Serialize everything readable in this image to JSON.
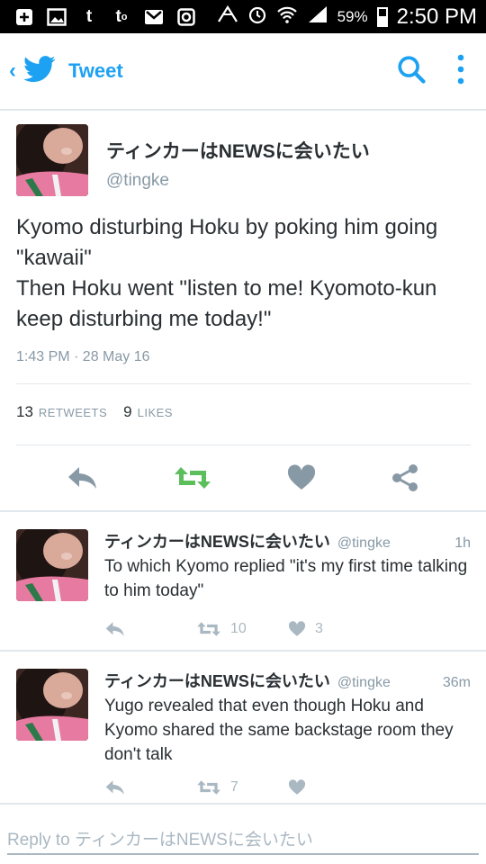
{
  "status_bar": {
    "battery": "59%",
    "time": "2:50 PM",
    "left_icons": [
      "plus-box-icon",
      "image-icon",
      "twitter-t-icon",
      "twitter-notify-icon",
      "gmail-icon",
      "instagram-icon"
    ]
  },
  "app_bar": {
    "title": "Tweet",
    "brand_color": "#1da1f2"
  },
  "main_tweet": {
    "name": "ティンカーはNEWSに会いたい",
    "handle": "@tingke",
    "text_line1": "Kyomo disturbing Hoku by poking him going \"kawaii\"",
    "text_line2": "Then Hoku went \"listen to me! Kyomoto-kun keep disturbing me today!\"",
    "timestamp": "1:43 PM · 28 May 16",
    "retweets_count": "13",
    "retweets_label": "RETWEETS",
    "likes_count": "9",
    "likes_label": "LIKES"
  },
  "replies": [
    {
      "name": "ティンカーはNEWSに会いたい",
      "handle": "@tingke",
      "time": "1h",
      "text": "To which Kyomo replied \"it's my first time talking to him today\"",
      "retweets": "10",
      "likes": "3"
    },
    {
      "name": "ティンカーはNEWSに会いたい",
      "handle": "@tingke",
      "time": "36m",
      "text": "Yugo revealed that even though Hoku and Kyomo shared the same backstage room they don't talk",
      "retweets": "7",
      "likes": ""
    }
  ],
  "reply_bar": {
    "prefix": "Reply to",
    "target": "ティンカーはNEWSに会いたい"
  },
  "colors": {
    "retweet_green": "#5cbf5c",
    "action_gray": "#8899a6",
    "light_gray": "#aab8c2"
  }
}
